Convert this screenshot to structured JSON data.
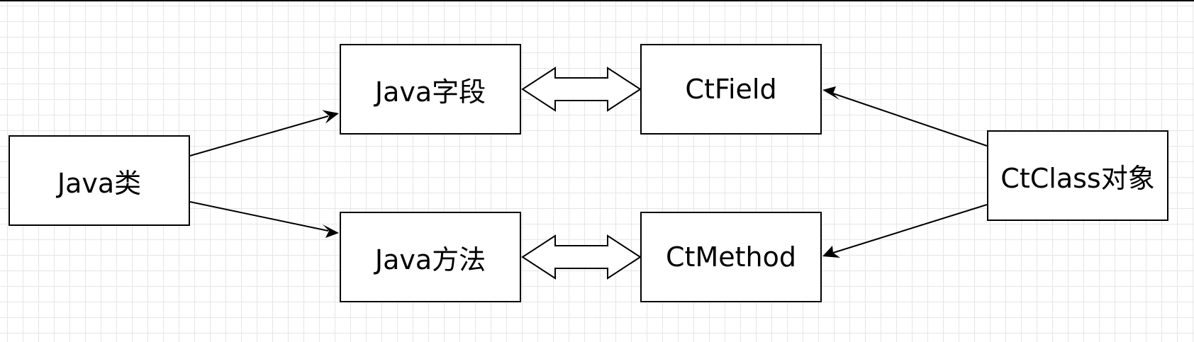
{
  "nodes": {
    "java_class": "Java类",
    "java_field": "Java字段",
    "java_method": "Java方法",
    "ctfield": "CtField",
    "ctmethod": "CtMethod",
    "ctclass": "CtClass对象"
  },
  "edges": [
    {
      "from": "java_class",
      "to": "java_field",
      "style": "arrow"
    },
    {
      "from": "java_class",
      "to": "java_method",
      "style": "arrow"
    },
    {
      "from": "java_field",
      "to": "ctfield",
      "style": "double-arrow"
    },
    {
      "from": "java_method",
      "to": "ctmethod",
      "style": "double-arrow"
    },
    {
      "from": "ctclass",
      "to": "ctfield",
      "style": "arrow"
    },
    {
      "from": "ctclass",
      "to": "ctmethod",
      "style": "arrow"
    }
  ],
  "colors": {
    "background": "#ffffff",
    "grid": "#e6e6e6",
    "stroke": "#000000"
  }
}
